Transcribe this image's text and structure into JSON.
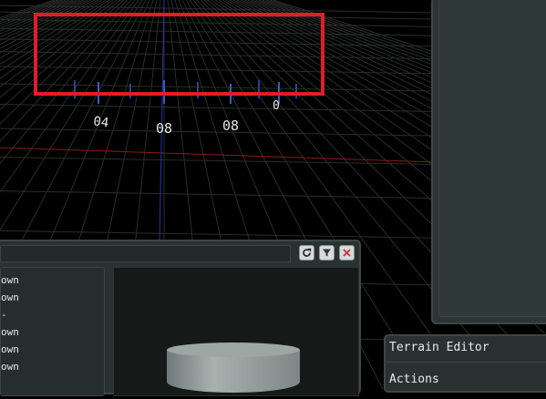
{
  "viewport": {
    "grid_color": "#2a2d2d",
    "x_axis_color": "#8a1a1a",
    "y_axis_color": "#2a33b0",
    "gizmo_labels": [
      "04",
      "08",
      "08",
      "0"
    ]
  },
  "asset_browser": {
    "items": [
      "own",
      "own",
      "-",
      "own",
      "own",
      "own"
    ],
    "preview_object": "cylinder"
  },
  "terrain_editor": {
    "title": "Terrain Editor",
    "section": "Actions"
  },
  "colors": {
    "highlight": "#e21d2b",
    "panel_bg": "#2a3231",
    "panel_border": "#3d4745"
  }
}
